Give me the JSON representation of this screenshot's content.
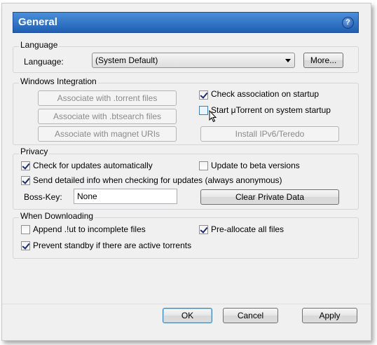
{
  "header": {
    "title": "General",
    "help_icon": "help-icon"
  },
  "language": {
    "group_title": "Language",
    "label": "Language:",
    "selected": "(System Default)",
    "more_button": "More..."
  },
  "windows_integration": {
    "group_title": "Windows Integration",
    "assoc_torrent": "Associate with .torrent files",
    "assoc_btsearch": "Associate with .btsearch files",
    "assoc_magnet": "Associate with magnet URIs",
    "check_assoc": {
      "label": "Check association on startup",
      "checked": true
    },
    "start_on_startup": {
      "label": "Start μTorrent on system startup",
      "checked": false
    },
    "install_ipv6": "Install IPv6/Teredo"
  },
  "privacy": {
    "group_title": "Privacy",
    "check_updates": {
      "label": "Check for updates automatically",
      "checked": true
    },
    "beta_versions": {
      "label": "Update to beta versions",
      "checked": false
    },
    "send_info": {
      "label": "Send detailed info when checking for updates (always anonymous)",
      "checked": true
    },
    "boss_key_label": "Boss-Key:",
    "boss_key_value": "None",
    "clear_private": "Clear Private Data"
  },
  "downloading": {
    "group_title": "When Downloading",
    "append_ut": {
      "label": "Append .!ut to incomplete files",
      "checked": false
    },
    "preallocate": {
      "label": "Pre-allocate all files",
      "checked": true
    },
    "prevent_standby": {
      "label": "Prevent standby if there are active torrents",
      "checked": true
    }
  },
  "footer": {
    "ok": "OK",
    "cancel": "Cancel",
    "apply": "Apply"
  }
}
